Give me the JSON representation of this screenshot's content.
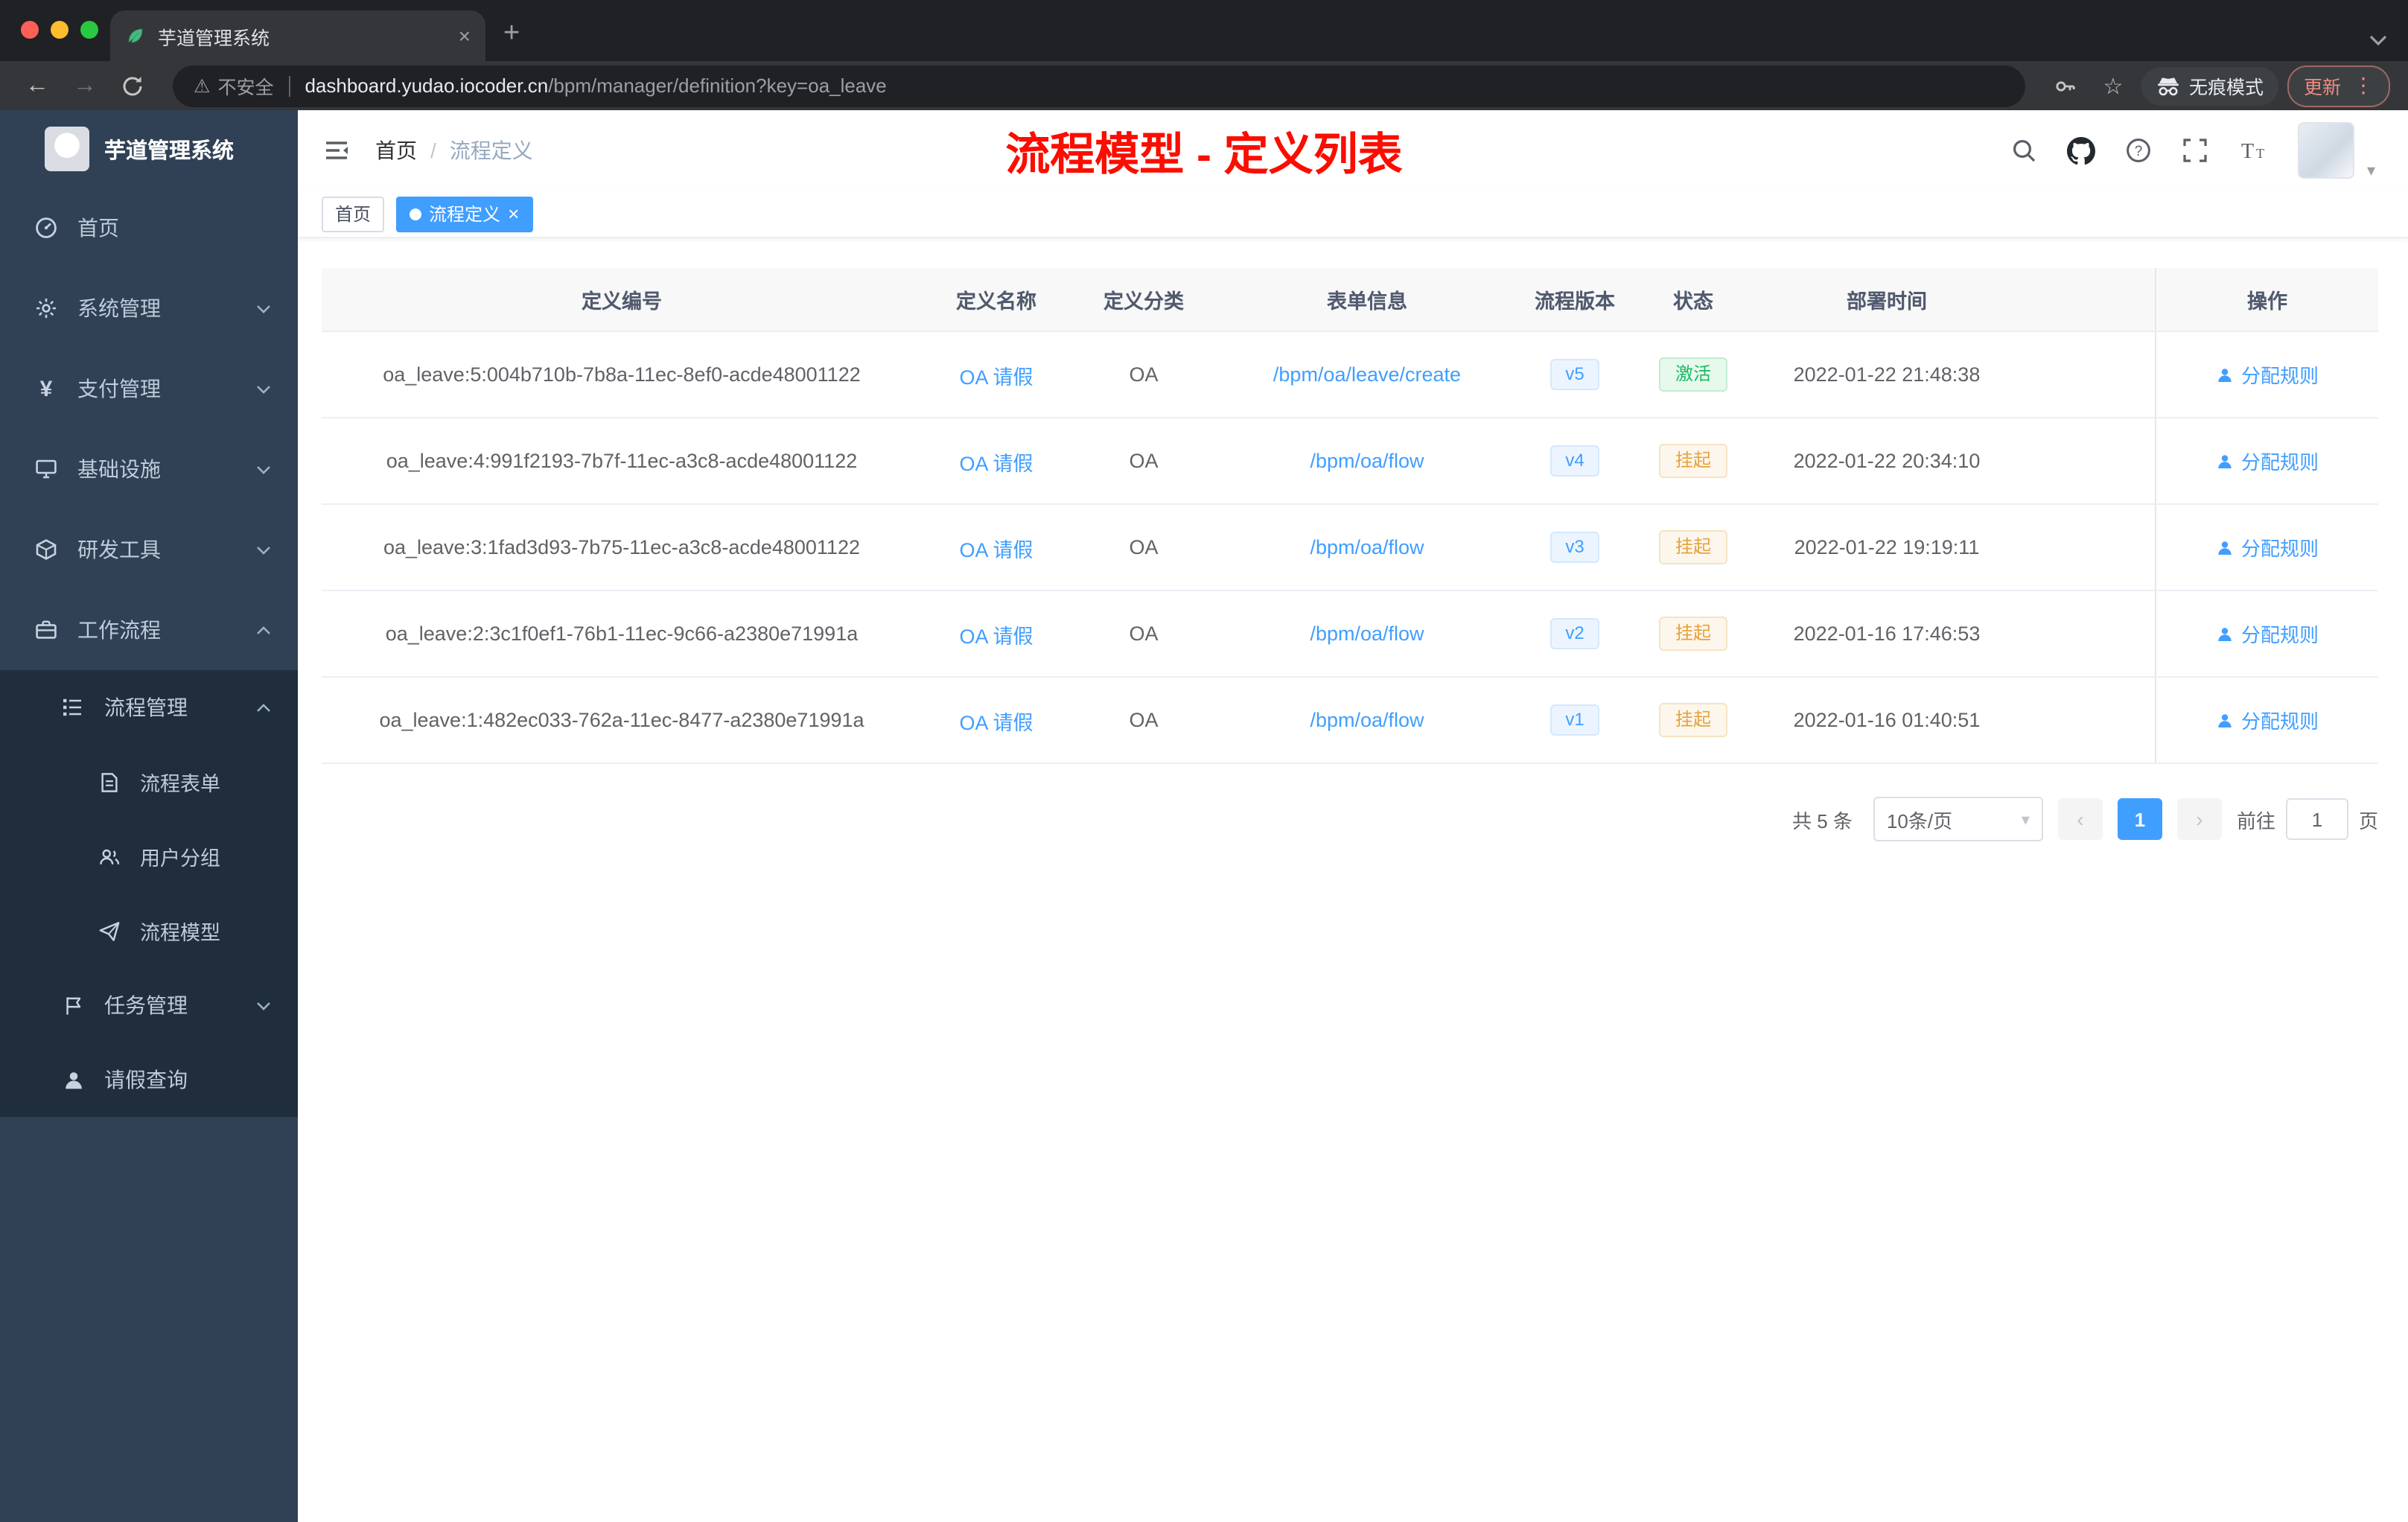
{
  "browser": {
    "tab_title": "芋道管理系统",
    "security_label": "不安全",
    "url_domain": "dashboard.yudao.iocoder.cn",
    "url_path": "/bpm/manager/definition?key=oa_leave",
    "incognito_label": "无痕模式",
    "update_label": "更新"
  },
  "icons": {
    "close": "×",
    "plus": "+",
    "dots": "⋮",
    "star": "☆",
    "warning": "⚠",
    "back": "←",
    "forward": "→",
    "yen": "¥",
    "question": "?",
    "caret_down": "▾",
    "prev": "‹",
    "next": "›"
  },
  "sidebar": {
    "logo_title": "芋道管理系统",
    "items": [
      {
        "label": "首页"
      },
      {
        "label": "系统管理"
      },
      {
        "label": "支付管理"
      },
      {
        "label": "基础设施"
      },
      {
        "label": "研发工具"
      },
      {
        "label": "工作流程"
      },
      {
        "label": "流程管理"
      },
      {
        "label": "流程表单"
      },
      {
        "label": "用户分组"
      },
      {
        "label": "流程模型"
      },
      {
        "label": "任务管理"
      },
      {
        "label": "请假查询"
      }
    ]
  },
  "header": {
    "breadcrumb": [
      "首页",
      "流程定义"
    ],
    "breadcrumb_separator": "/",
    "annotation": "流程模型 - 定义列表"
  },
  "tags": [
    {
      "label": "首页"
    },
    {
      "label": "流程定义"
    }
  ],
  "table": {
    "columns": [
      "定义编号",
      "定义名称",
      "定义分类",
      "表单信息",
      "流程版本",
      "状态",
      "部署时间",
      "操作"
    ],
    "rows": [
      {
        "id": "oa_leave:5:004b710b-7b8a-11ec-8ef0-acde48001122",
        "name": "OA 请假",
        "category": "OA",
        "form": "/bpm/oa/leave/create",
        "version": "v5",
        "status": "激活",
        "time": "2022-01-22 21:48:38",
        "action": "分配规则"
      },
      {
        "id": "oa_leave:4:991f2193-7b7f-11ec-a3c8-acde48001122",
        "name": "OA 请假",
        "category": "OA",
        "form": "/bpm/oa/flow",
        "version": "v4",
        "status": "挂起",
        "time": "2022-01-22 20:34:10",
        "action": "分配规则"
      },
      {
        "id": "oa_leave:3:1fad3d93-7b75-11ec-a3c8-acde48001122",
        "name": "OA 请假",
        "category": "OA",
        "form": "/bpm/oa/flow",
        "version": "v3",
        "status": "挂起",
        "time": "2022-01-22 19:19:11",
        "action": "分配规则"
      },
      {
        "id": "oa_leave:2:3c1f0ef1-76b1-11ec-9c66-a2380e71991a",
        "name": "OA 请假",
        "category": "OA",
        "form": "/bpm/oa/flow",
        "version": "v2",
        "status": "挂起",
        "time": "2022-01-16 17:46:53",
        "action": "分配规则"
      },
      {
        "id": "oa_leave:1:482ec033-762a-11ec-8477-a2380e71991a",
        "name": "OA 请假",
        "category": "OA",
        "form": "/bpm/oa/flow",
        "version": "v1",
        "status": "挂起",
        "time": "2022-01-16 01:40:51",
        "action": "分配规则"
      }
    ]
  },
  "pagination": {
    "total": "共 5 条",
    "page_size": "10条/页",
    "current_page": "1",
    "goto_prefix": "前往",
    "goto_value": "1",
    "goto_suffix": "页"
  }
}
